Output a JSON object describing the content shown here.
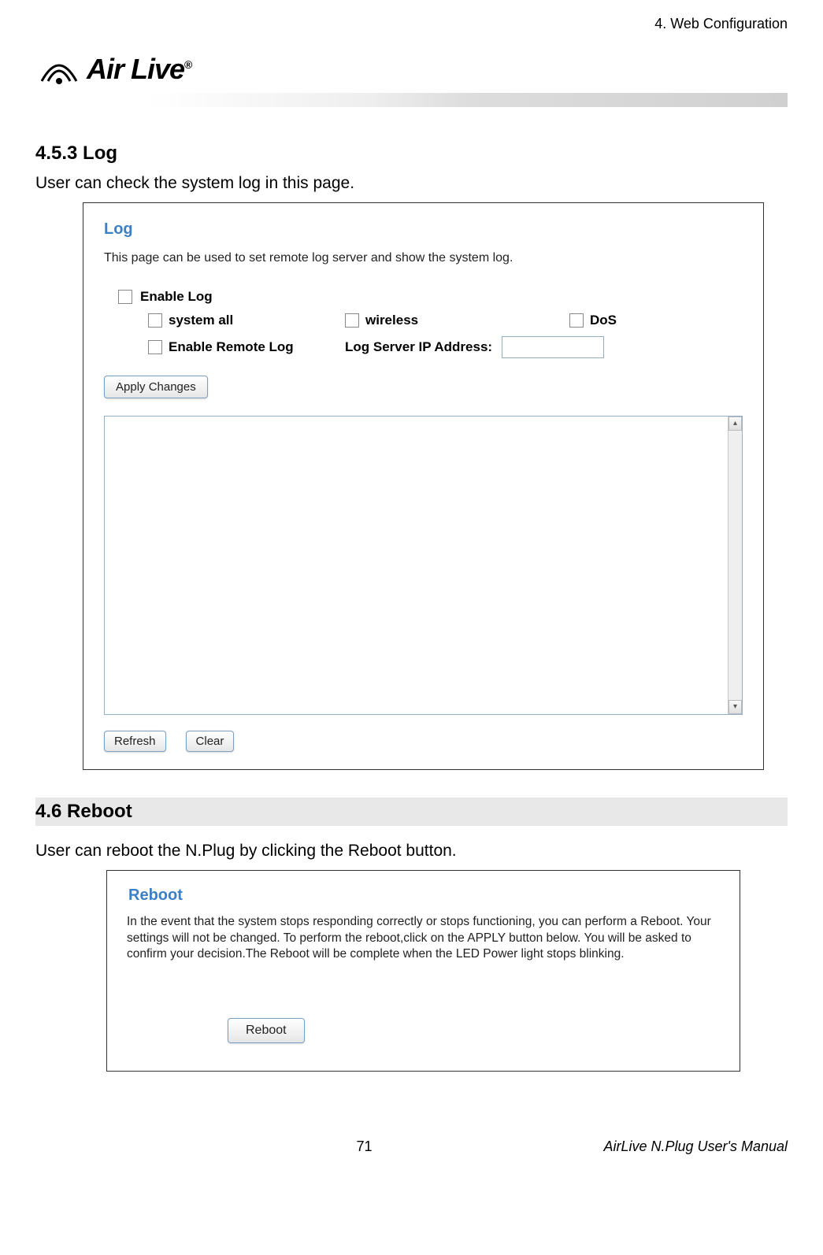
{
  "header": {
    "chapter": "4. Web Configuration",
    "logo_text": "Air Live",
    "logo_reg": "®"
  },
  "section_log": {
    "heading": "4.5.3 Log",
    "text": "User can check the system log in this page."
  },
  "log_panel": {
    "title": "Log",
    "description": "This page can be used to set remote log server and show the system log.",
    "enable_log": "Enable Log",
    "system_all": "system all",
    "wireless": "wireless",
    "dos": "DoS",
    "enable_remote": "Enable Remote Log",
    "ip_label": "Log Server IP Address:",
    "ip_value": "",
    "apply_btn": "Apply Changes",
    "refresh_btn": "Refresh",
    "clear_btn": "Clear"
  },
  "section_reboot": {
    "heading": "4.6   Reboot",
    "text": "User can reboot the N.Plug by clicking the Reboot button."
  },
  "reboot_panel": {
    "title": "Reboot",
    "description": "In the event that the system stops responding correctly or stops functioning, you can perform a Reboot. Your settings will not be changed. To perform the reboot,click on the APPLY button below. You will be asked to confirm your decision.The Reboot will be complete when the LED Power light stops blinking.",
    "button": "Reboot"
  },
  "footer": {
    "page": "71",
    "manual": "AirLive N.Plug User's Manual"
  }
}
